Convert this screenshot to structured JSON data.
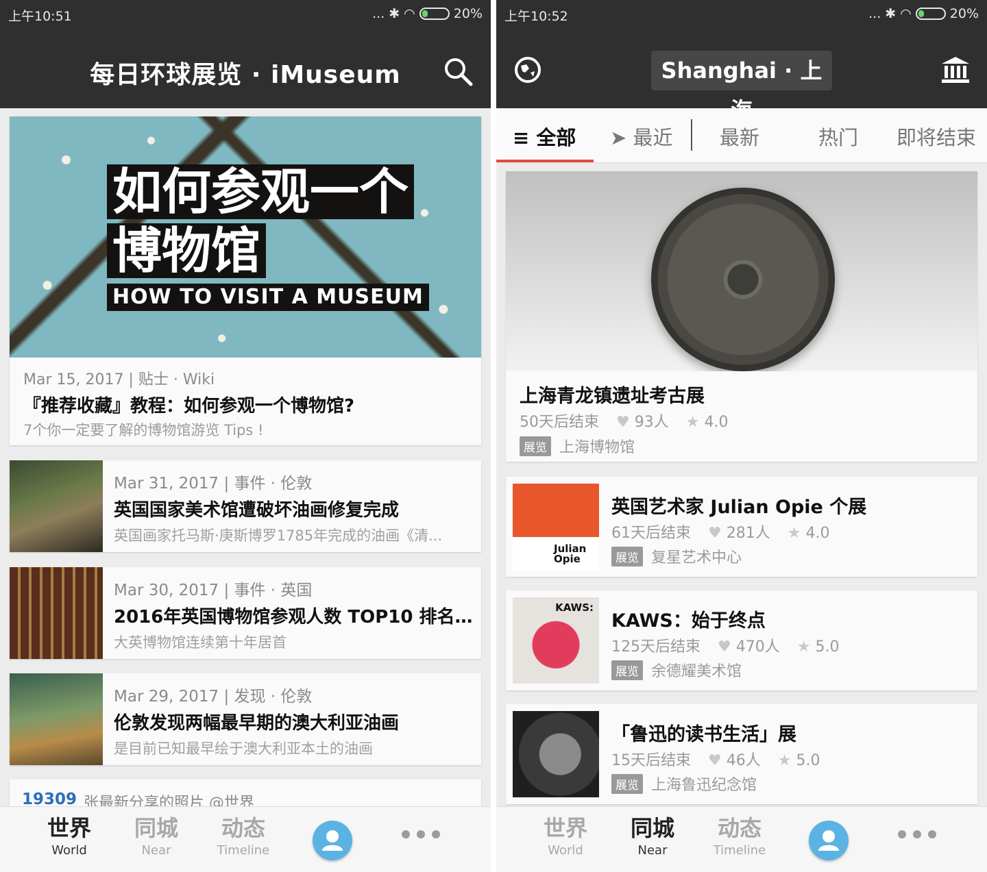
{
  "left": {
    "status": {
      "time": "上午10:51",
      "battery": "20%",
      "dots": "..."
    },
    "header": {
      "title": "每日环球展览 · iMuseum"
    },
    "hero": {
      "headline_line1": "如何参观一个",
      "headline_line2": "博物馆",
      "headline_en": "HOW TO VISIT A MUSEUM",
      "meta": "Mar 15, 2017 | 贴士 · Wiki",
      "title": "『推荐收藏』教程：如何参观一个博物馆?",
      "summary": "7个你一定要了解的博物馆游览 Tips !"
    },
    "news": [
      {
        "meta": "Mar 31, 2017 | 事件 · 伦敦",
        "title": "英国国家美术馆遭破坏油画修复完成",
        "summary": "英国画家托马斯·庚斯博罗1785年完成的油画《清..."
      },
      {
        "meta": "Mar 30, 2017 | 事件 · 英国",
        "title": "2016年英国博物馆参观人数 TOP10 排名...",
        "summary": "大英博物馆连续第十年居首"
      },
      {
        "meta": "Mar 29, 2017 | 发现 · 伦敦",
        "title": "伦敦发现两幅最早期的澳大利亚油画",
        "summary": "是目前已知最早绘于澳大利亚本土的油画"
      }
    ],
    "share": {
      "count": "19309",
      "text": "张最新分享的照片 @世界"
    }
  },
  "right": {
    "status": {
      "time": "上午10:52",
      "battery": "20%",
      "dots": "..."
    },
    "header": {
      "city": "Shanghai · 上海"
    },
    "tabs": [
      {
        "label": "≡ 全部"
      },
      {
        "label": "➤ 最近"
      },
      {
        "label": "最新"
      },
      {
        "label": "热门"
      },
      {
        "label": "即将结束"
      }
    ],
    "featured": {
      "title": "上海青龙镇遗址考古展",
      "ends": "50天后结束",
      "likes": "93人",
      "rating": "4.0",
      "tag": "展览",
      "venue": "上海博物馆"
    },
    "exhibitions": [
      {
        "title": "英国艺术家 Julian Opie 个展",
        "ends": "61天后结束",
        "likes": "281人",
        "rating": "4.0",
        "tag": "展览",
        "venue": "复星艺术中心",
        "thumb_text": "Julian Opie"
      },
      {
        "title": "KAWS：始于终点",
        "ends": "125天后结束",
        "likes": "470人",
        "rating": "5.0",
        "tag": "展览",
        "venue": "余德耀美术馆",
        "thumb_text": "KAWS:"
      },
      {
        "title": "「鲁迅的读书生活」展",
        "ends": "15天后结束",
        "likes": "46人",
        "rating": "5.0",
        "tag": "展览",
        "venue": "上海鲁迅纪念馆"
      }
    ]
  },
  "nav": {
    "world_cn": "世界",
    "world_en": "World",
    "near_cn": "同城",
    "near_en": "Near",
    "timeline_cn": "动态",
    "timeline_en": "Timeline"
  },
  "colors": {
    "appbar": "#2f2f2f",
    "accent_red": "#e14b3a",
    "link_blue": "#2c6fb7",
    "avatar_blue": "#5ab3e2"
  }
}
